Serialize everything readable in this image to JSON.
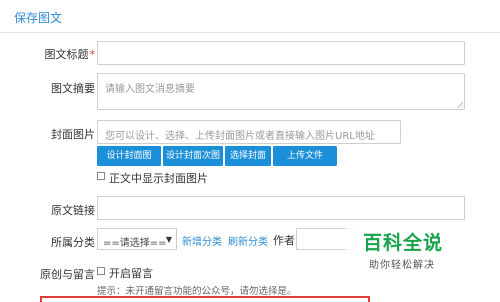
{
  "header": {
    "title": "保存图文"
  },
  "form": {
    "title_label": "图文标题",
    "title_required": "*",
    "summary_label": "图文摘要",
    "summary_placeholder": "请输入图文消息摘要",
    "cover_label": "封面图片",
    "cover_placeholder": "您可以设计、选择、上传封面图片或者直接输入图片URL地址",
    "buttons": [
      "设计封面图",
      "设计封面次图",
      "选择封面",
      "上传文件"
    ],
    "show_cover_label": "正文中显示封面图片",
    "original_link_label": "原文链接",
    "category_label": "所属分类",
    "category_select": "==请选择==",
    "add_category": "新增分类",
    "refresh_category": "刷新分类",
    "author_label": "作者",
    "original_label": "原创与留言",
    "open_comment_label": "开启留言",
    "hint": "提示：未开通留言功能的公众号，请勿选择是。"
  },
  "watermark": {
    "title": "百科全说",
    "subtitle": "助你轻松解决"
  }
}
